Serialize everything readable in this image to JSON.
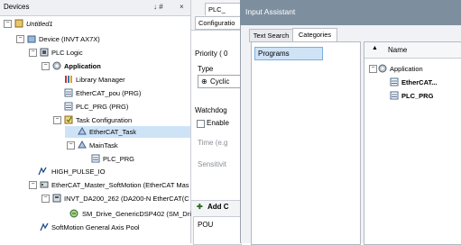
{
  "devices_panel": {
    "title": "Devices",
    "pin": "↓ #",
    "close": "×",
    "tree": [
      {
        "label": "Untitled1"
      },
      {
        "label": "Device (INVT AX7X)"
      },
      {
        "label": "PLC Logic"
      },
      {
        "label": "Application"
      },
      {
        "label": "Library Manager"
      },
      {
        "label": "EtherCAT_pou (PRG)"
      },
      {
        "label": "PLC_PRG (PRG)"
      },
      {
        "label": "Task Configuration"
      },
      {
        "label": "EtherCAT_Task"
      },
      {
        "label": "MainTask"
      },
      {
        "label": "PLC_PRG"
      },
      {
        "label": "HIGH_PULSE_IO"
      },
      {
        "label": "EtherCAT_Master_SoftMotion (EtherCAT Mas"
      },
      {
        "label": "INVT_DA200_262 (DA200-N EtherCAT(C"
      },
      {
        "label": "SM_Drive_GenericDSP402 (SM_Driv"
      },
      {
        "label": "SoftMotion General Axis Pool"
      }
    ]
  },
  "editor": {
    "tab_label": "PLC_",
    "config_tab": "Configuratio",
    "priority_label": "Priority ( 0",
    "type_label": "Type",
    "type_value": "Cyclic",
    "watchdog_label": "Watchdog",
    "enable_label": "Enable",
    "time_label": "Time (e.g",
    "sensitivity_label": "Sensitivit",
    "add_call_label": "Add C",
    "pou_header": "POU"
  },
  "dialog": {
    "title": "Input Assistant",
    "tabs": [
      "Text Search",
      "Categories"
    ],
    "categories": [
      "Programs"
    ],
    "column_name": "Name",
    "items": [
      {
        "label": "Application"
      },
      {
        "label": "EtherCAT..."
      },
      {
        "label": "PLC_PRG"
      }
    ]
  }
}
